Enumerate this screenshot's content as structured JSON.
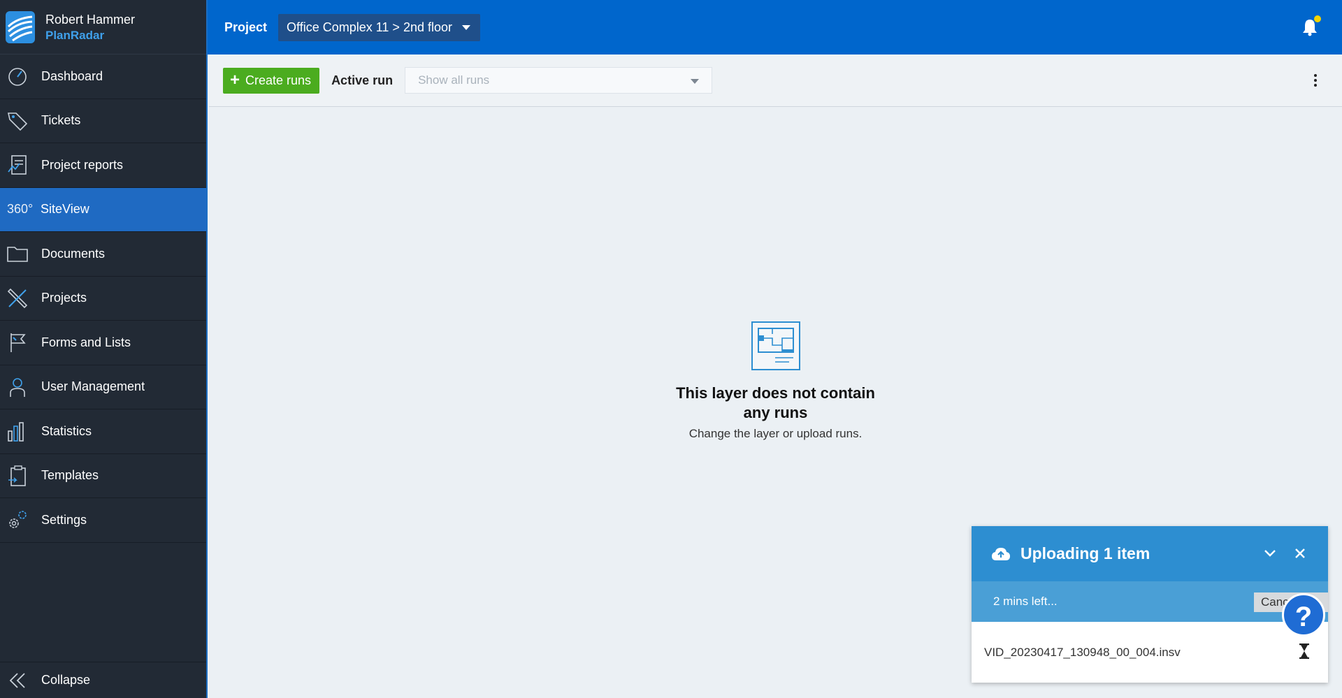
{
  "user": {
    "name": "Robert Hammer",
    "brand": "PlanRadar"
  },
  "sidebar": {
    "items": [
      {
        "label": "Dashboard",
        "icon": "dashboard-gauge-icon"
      },
      {
        "label": "Tickets",
        "icon": "tag-icon"
      },
      {
        "label": "Project reports",
        "icon": "report-icon"
      },
      {
        "label": "SiteView",
        "icon": "360-icon",
        "icon_text": "360°",
        "active": true
      },
      {
        "label": "Documents",
        "icon": "folder-icon"
      },
      {
        "label": "Projects",
        "icon": "ruler-pencil-icon"
      },
      {
        "label": "Forms and Lists",
        "icon": "flag-icon"
      },
      {
        "label": "User Management",
        "icon": "user-icon"
      },
      {
        "label": "Statistics",
        "icon": "bar-chart-icon"
      },
      {
        "label": "Templates",
        "icon": "clipboard-icon"
      },
      {
        "label": "Settings",
        "icon": "gears-icon"
      }
    ],
    "collapse_label": "Collapse"
  },
  "topbar": {
    "project_label": "Project",
    "project_selected": "Office Complex 11 > 2nd floor"
  },
  "toolbar": {
    "create_label": "Create runs",
    "active_run_label": "Active run",
    "runs_placeholder": "Show all runs"
  },
  "empty_state": {
    "title": "This layer does not contain any runs",
    "subtitle": "Change the layer or upload runs."
  },
  "upload": {
    "title": "Uploading 1 item",
    "time_left": "2 mins left...",
    "cancel_label": "Cancel",
    "file_name": "VID_20230417_130948_00_004.insv"
  },
  "help_label": "?",
  "colors": {
    "primary": "#0066cc",
    "sidebar": "#222a35",
    "green": "#4bac1f",
    "notification_dot": "#f5d400"
  }
}
